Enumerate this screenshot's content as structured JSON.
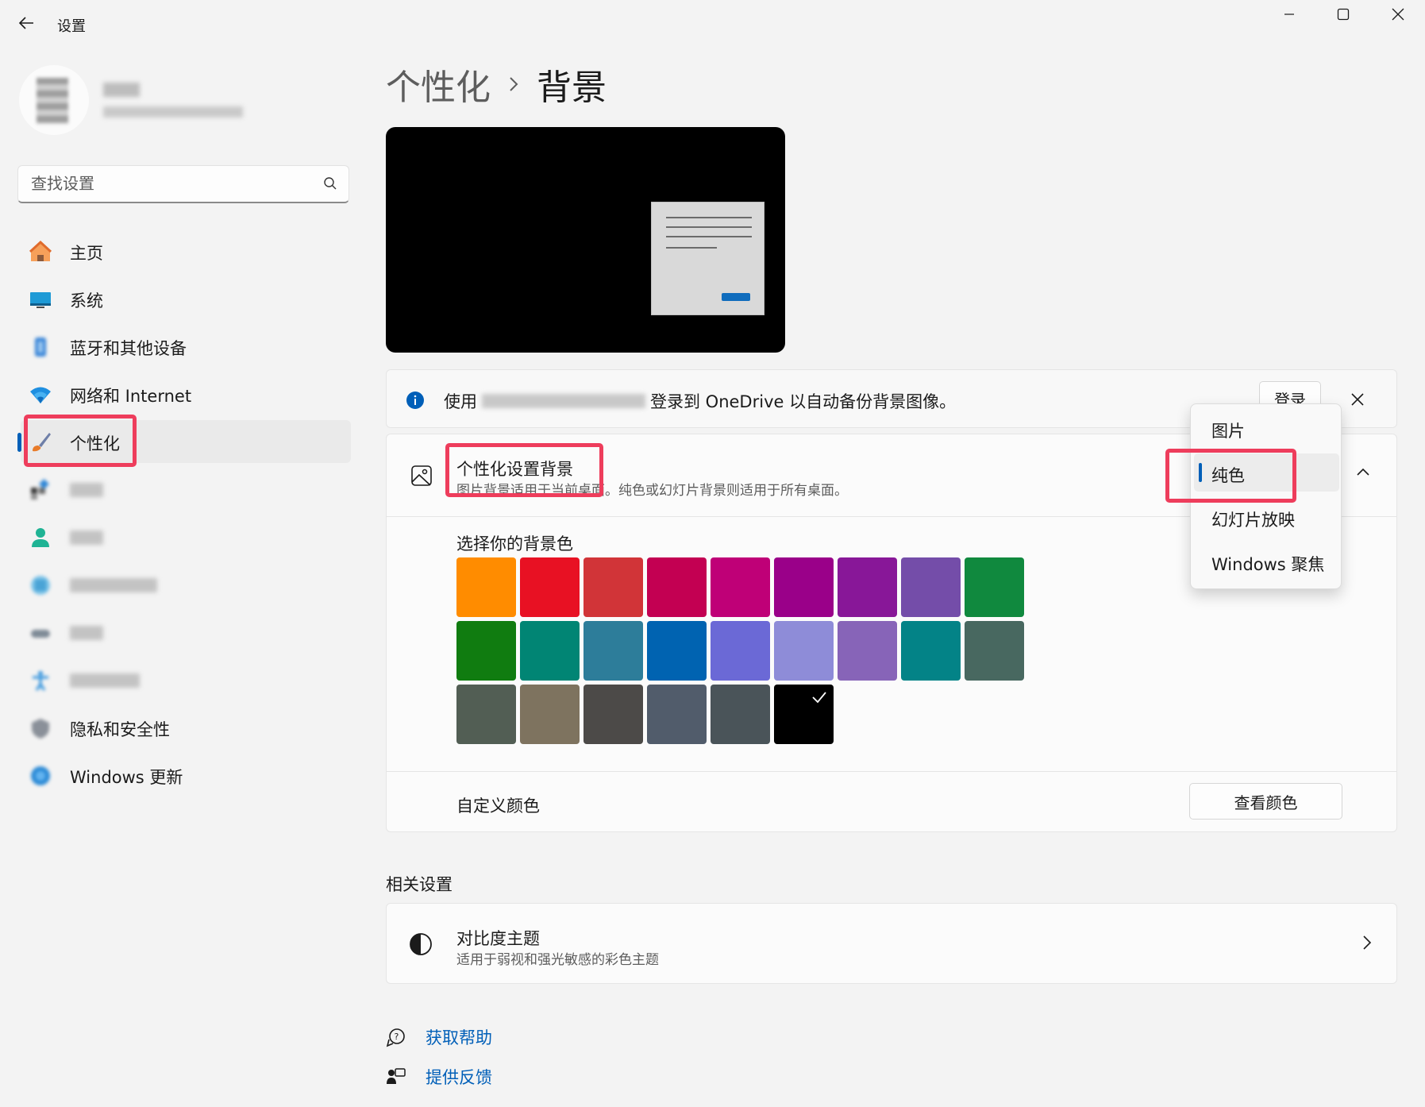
{
  "app": {
    "title": "设置"
  },
  "search": {
    "placeholder": "查找设置"
  },
  "nav": {
    "items": [
      {
        "label": "主页"
      },
      {
        "label": "系统"
      },
      {
        "label": "蓝牙和其他设备"
      },
      {
        "label": "网络和 Internet"
      },
      {
        "label": "个性化"
      },
      {
        "label": ""
      },
      {
        "label": ""
      },
      {
        "label": ""
      },
      {
        "label": ""
      },
      {
        "label": ""
      },
      {
        "label": "隐私和安全性"
      },
      {
        "label": "Windows 更新"
      }
    ],
    "selected": "个性化"
  },
  "breadcrumb": {
    "parent": "个性化",
    "separator": "›",
    "current": "背景"
  },
  "info_bar": {
    "prefix": "使用",
    "suffix": "登录到 OneDrive 以自动备份背景图像。",
    "login_label": "登录"
  },
  "background": {
    "title": "个性化设置背景",
    "description": "图片背景适用于当前桌面。纯色或幻灯片背景则适用于所有桌面。",
    "color_label": "选择你的背景色",
    "swatch_colors": [
      "#ff8c00",
      "#e81123",
      "#d13438",
      "#c30052",
      "#bf0077",
      "#9a0089",
      "#881798",
      "#744da9",
      "#10893e",
      "#107c10",
      "#018574",
      "#2d7d9a",
      "#0063b1",
      "#6b69d6",
      "#8e8cd8",
      "#8764b8",
      "#038387",
      "#486860",
      "#525e54",
      "#7e735f",
      "#4c4a48",
      "#515c6b",
      "#4a5459",
      "#000000"
    ],
    "selected_swatch": 23,
    "custom_label": "自定义颜色",
    "view_colors_label": "查看颜色"
  },
  "dropdown": {
    "options": [
      "图片",
      "纯色",
      "幻灯片放映",
      "Windows 聚焦"
    ],
    "selected": "纯色"
  },
  "related": {
    "title": "相关设置",
    "contrast_title": "对比度主题",
    "contrast_desc": "适用于弱视和强光敏感的彩色主题"
  },
  "footer": {
    "help_label": "获取帮助",
    "feedback_label": "提供反馈"
  },
  "colors": {
    "accent": "#005fb8",
    "highlight": "#ee3d5c"
  }
}
